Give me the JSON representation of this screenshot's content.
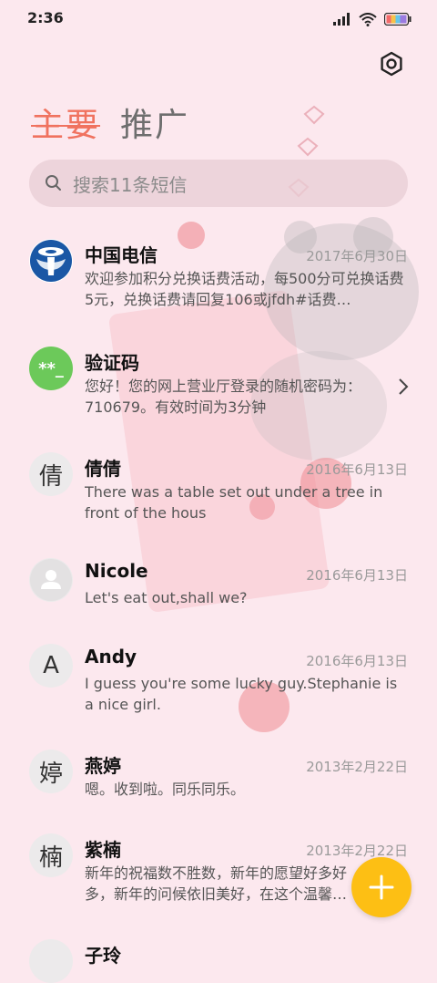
{
  "status_bar": {
    "time": "2:36"
  },
  "tabs": [
    {
      "label": "主要",
      "active": true
    },
    {
      "label": "推广",
      "active": false
    }
  ],
  "search": {
    "placeholder": "搜索11条短信"
  },
  "conversations": [
    {
      "name": "中国电信",
      "date": "2017年6月30日",
      "preview": "欢迎参加积分兑换话费活动，每500分可兑换话费5元，兑换话费请回复106或jfdh#话费…",
      "avatar": "telecom-logo-icon"
    },
    {
      "name": "验证码",
      "date": "",
      "preview": "您好！您的网上营业厅登录的随机密码为：710679。有效时间为3分钟",
      "avatar_text": "**_",
      "avatar_color": "#6cc95a"
    },
    {
      "name": "倩倩",
      "date": "2016年6月13日",
      "preview": "There was a table set out under a tree in front of the hous",
      "avatar_text": "倩"
    },
    {
      "name": "Nicole",
      "date": "2016年6月13日",
      "preview": "Let's eat out,shall we?",
      "avatar": "person-icon"
    },
    {
      "name": "Andy",
      "date": "2016年6月13日",
      "preview": "I guess you're some lucky guy.Stephanie is a nice girl.",
      "avatar_text": "A"
    },
    {
      "name": "燕婷",
      "date": "2013年2月22日",
      "preview": "嗯。收到啦。同乐同乐。",
      "avatar_text": "婷"
    },
    {
      "name": "紫楠",
      "date": "2013年2月22日",
      "preview": "新年的祝福数不胜数，新年的愿望好多好多，新年的问候依旧美好，在这个温馨的时刻",
      "avatar_text": "楠"
    },
    {
      "name": "子玲",
      "date": "",
      "preview": "",
      "avatar_text": ""
    }
  ],
  "colors": {
    "accent": "#f0725f",
    "fab": "#fdbf14",
    "background": "#fce8ee"
  }
}
